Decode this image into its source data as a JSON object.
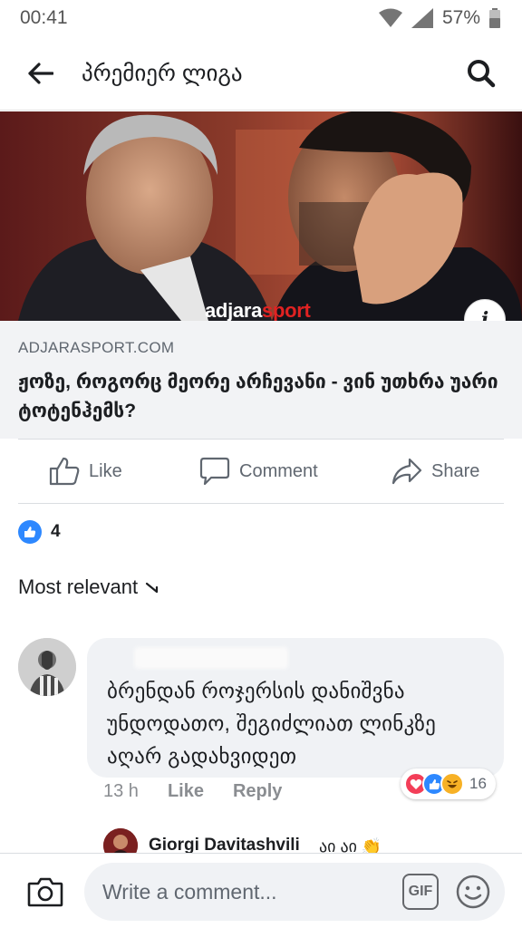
{
  "status_bar": {
    "time": "00:41",
    "battery": "57%",
    "icons": [
      "wifi-icon",
      "signal-icon",
      "battery-icon"
    ]
  },
  "header": {
    "title": "პრემიერ ლიგა",
    "back_icon": "back-arrow-icon",
    "search_icon": "search-icon"
  },
  "article": {
    "image_brand_part1": "adjara",
    "image_brand_part2": "sport",
    "info_label": "i",
    "domain": "ADJARASPORT.COM",
    "title": "ჟოზე, როგორც მეორე არჩევანი - ვინ უთხრა უარი ტოტენჰემს?"
  },
  "actions": {
    "like": "Like",
    "comment": "Comment",
    "share": "Share"
  },
  "reactions": {
    "count": "4"
  },
  "sort": {
    "label": "Most relevant"
  },
  "comment": {
    "text": "ბრენდან როჯერსის დანიშვნა უნდოდათო, შეგიძლიათ ლინკზე აღარ გადახვიდეთ",
    "time": "13 h",
    "like": "Like",
    "reply": "Reply",
    "reaction_count": "16"
  },
  "reply_preview": {
    "author": "Giorgi Davitashvili",
    "snippet": "აი აი 👏"
  },
  "composer": {
    "placeholder": "Write a comment...",
    "gif_label": "GIF"
  },
  "colors": {
    "accent": "#2d88ff",
    "love": "#f33e58",
    "haha": "#f7b125",
    "brand_red": "#e12222"
  }
}
